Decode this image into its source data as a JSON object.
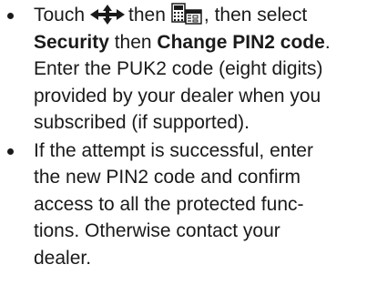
{
  "document": {
    "items": [
      {
        "line1_pre": "Touch",
        "line1_mid": "then",
        "line1_post": ", then select",
        "line2_bold1": "Security",
        "line2_mid": " then ",
        "line2_bold2": "Change PIN2 code",
        "line2_end": ".",
        "line3": "Enter the PUK2 code (eight digits)",
        "line4": "provided by your dealer when you",
        "line5": "subscribed (if supported).",
        "icon1": "navigation-arrows-icon",
        "icon2": "settings-menu-icon"
      },
      {
        "line1": "If the attempt is successful, enter",
        "line2": "the new PIN2 code and confirm",
        "line3": "access to all the protected func-",
        "line4": "tions. Otherwise contact your",
        "line5": "dealer."
      }
    ]
  }
}
